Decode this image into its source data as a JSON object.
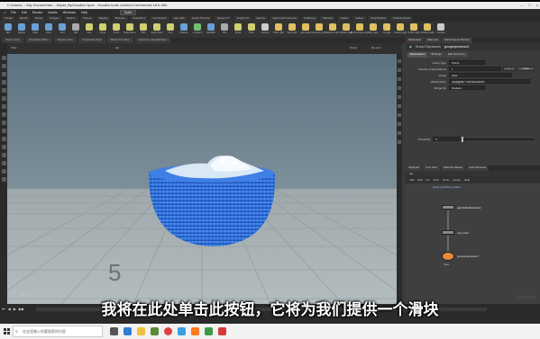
{
  "window": {
    "title": "C:/Users/..../My Documents/..../liquid_flip/houdini.hipnc - Houdini Indie Limited-Commercial 18.0.460"
  },
  "menu": [
    "File",
    "Edit",
    "Render",
    "Assets",
    "Windows",
    "Help"
  ],
  "desktop": "Build",
  "shelf_tabs": [
    "Create",
    "Modify",
    "Model",
    "Polygon",
    "Deform",
    "Texture",
    "Rigging",
    "Muscles",
    "Characters",
    "Constraints",
    "Hair Utils",
    "Guide Process",
    "Terrain FX",
    "Simple FX",
    "Volume",
    "Lights and Cameras",
    "Collisions",
    "Particles",
    "Grains",
    "Vellum",
    "Rigid Bodies",
    "Particle Fluids",
    "Viscous Fluids",
    "Oceans",
    "Fluid Containers",
    "Populate Containers",
    "Container Tools",
    "Pyro FX",
    "Sparse Pyro FX",
    "FEM",
    "Wires",
    "Crowds",
    "Drive Simulation"
  ],
  "shelf_tools": [
    {
      "label": "Box",
      "color": "#6aa0d8"
    },
    {
      "label": "Sphere",
      "color": "#6aa0d8"
    },
    {
      "label": "Tube",
      "color": "#6aa0d8"
    },
    {
      "label": "Torus",
      "color": "#6aa0d8"
    },
    {
      "label": "Grid",
      "color": "#6aa0d8"
    },
    {
      "label": "Null",
      "color": "#aaaaaa"
    },
    {
      "label": "Line",
      "color": "#d0d070"
    },
    {
      "label": "Circle",
      "color": "#d0d070"
    },
    {
      "label": "Curve",
      "color": "#d0d070"
    },
    {
      "label": "Draw Curve",
      "color": "#d0d070"
    },
    {
      "label": "Path",
      "color": "#d0d070"
    },
    {
      "label": "Spray Paint",
      "color": "#d0d070"
    },
    {
      "label": "Font",
      "color": "#d0d070"
    },
    {
      "label": "Platonic",
      "color": "#6aa0d8"
    },
    {
      "label": "L-System",
      "color": "#70c070"
    },
    {
      "label": "Metaball",
      "color": "#6aa0d8"
    },
    {
      "label": "File",
      "color": "#aaaaaa"
    },
    {
      "label": "Spiral",
      "color": "#d0d070"
    },
    {
      "label": "Helix",
      "color": "#d0d070"
    },
    {
      "label": "Camera",
      "color": "#cccccc"
    },
    {
      "label": "Point Light",
      "color": "#e0c060"
    },
    {
      "label": "Spot Light",
      "color": "#e0c060"
    },
    {
      "label": "Area Light",
      "color": "#e0c060"
    },
    {
      "label": "Geometry Light",
      "color": "#e0c060"
    },
    {
      "label": "Volume Light",
      "color": "#e0c060"
    },
    {
      "label": "Distant Light",
      "color": "#e0c060"
    },
    {
      "label": "Environment Light",
      "color": "#e0c060"
    },
    {
      "label": "Sky Light",
      "color": "#e0c060"
    },
    {
      "label": "GI Light",
      "color": "#e0c060"
    },
    {
      "label": "Caustic Light",
      "color": "#e0c060"
    },
    {
      "label": "Portal Light",
      "color": "#e0c060"
    },
    {
      "label": "Ambient Light",
      "color": "#e0c060"
    },
    {
      "label": "Camera",
      "color": "#cccccc"
    }
  ],
  "path_tabs": [
    "Scene View",
    "Animation Editor",
    "Render View",
    "Composite View",
    "Motion FX View",
    "Geometry Spreadsheet"
  ],
  "viewport": {
    "label": "View",
    "obj_path": "obj",
    "camera": "Persp",
    "cam_menu": "No cam"
  },
  "frame_number": "5",
  "parameters": {
    "tabs": [
      "Parameter",
      "Take List",
      "Performance Monitor"
    ],
    "node_type": "Group Expression",
    "node_name": "groupexpression1",
    "subtabs": [
      "Expressions",
      "Bindings",
      "Edit Geometry",
      "Group"
    ],
    "group_type_label": "Group Type",
    "group_type_value": "Points",
    "num_expr_label": "Number of Expressions",
    "num_expr_value": "1",
    "group_label": "Group",
    "group_value": "blast",
    "vex_label": "VEXpression",
    "vex_value": "rand(@id) < ch(\"threshold\")",
    "merge_label": "Merge Op",
    "merge_value": "Replace",
    "threshold_label": "Threshold",
    "threshold_value": "0",
    "add_label": "+",
    "clear_label": "Clear"
  },
  "network": {
    "tabs": [
      "obj/liquid",
      "Tree View",
      "Material Palette",
      "Asset Browser"
    ],
    "path": "obj",
    "menu": [
      "Add",
      "Edit",
      "Go",
      "View",
      "Tools",
      "Layout",
      "Help"
    ],
    "nodes": [
      {
        "name": "particlefluidsurface1",
        "sub": ""
      },
      {
        "name": "null_rest1",
        "sub": ""
      },
      {
        "name": "groupexpression1",
        "sub": "blast"
      }
    ],
    "context_label": "Geometry",
    "header_label": "liquid_particles_tutorial"
  },
  "subtitle": "我将在此处单击此按钮，它将为我们提供一个滑块",
  "taskbar": {
    "search_placeholder": "在这里输入你要搜索的内容"
  },
  "colors": {
    "sky_top": "#5c7281",
    "sky_bottom": "#9aa8ae",
    "floor": "#a8b2b4",
    "liquid": "#2a6bd8",
    "foam": "#eef6fb"
  }
}
